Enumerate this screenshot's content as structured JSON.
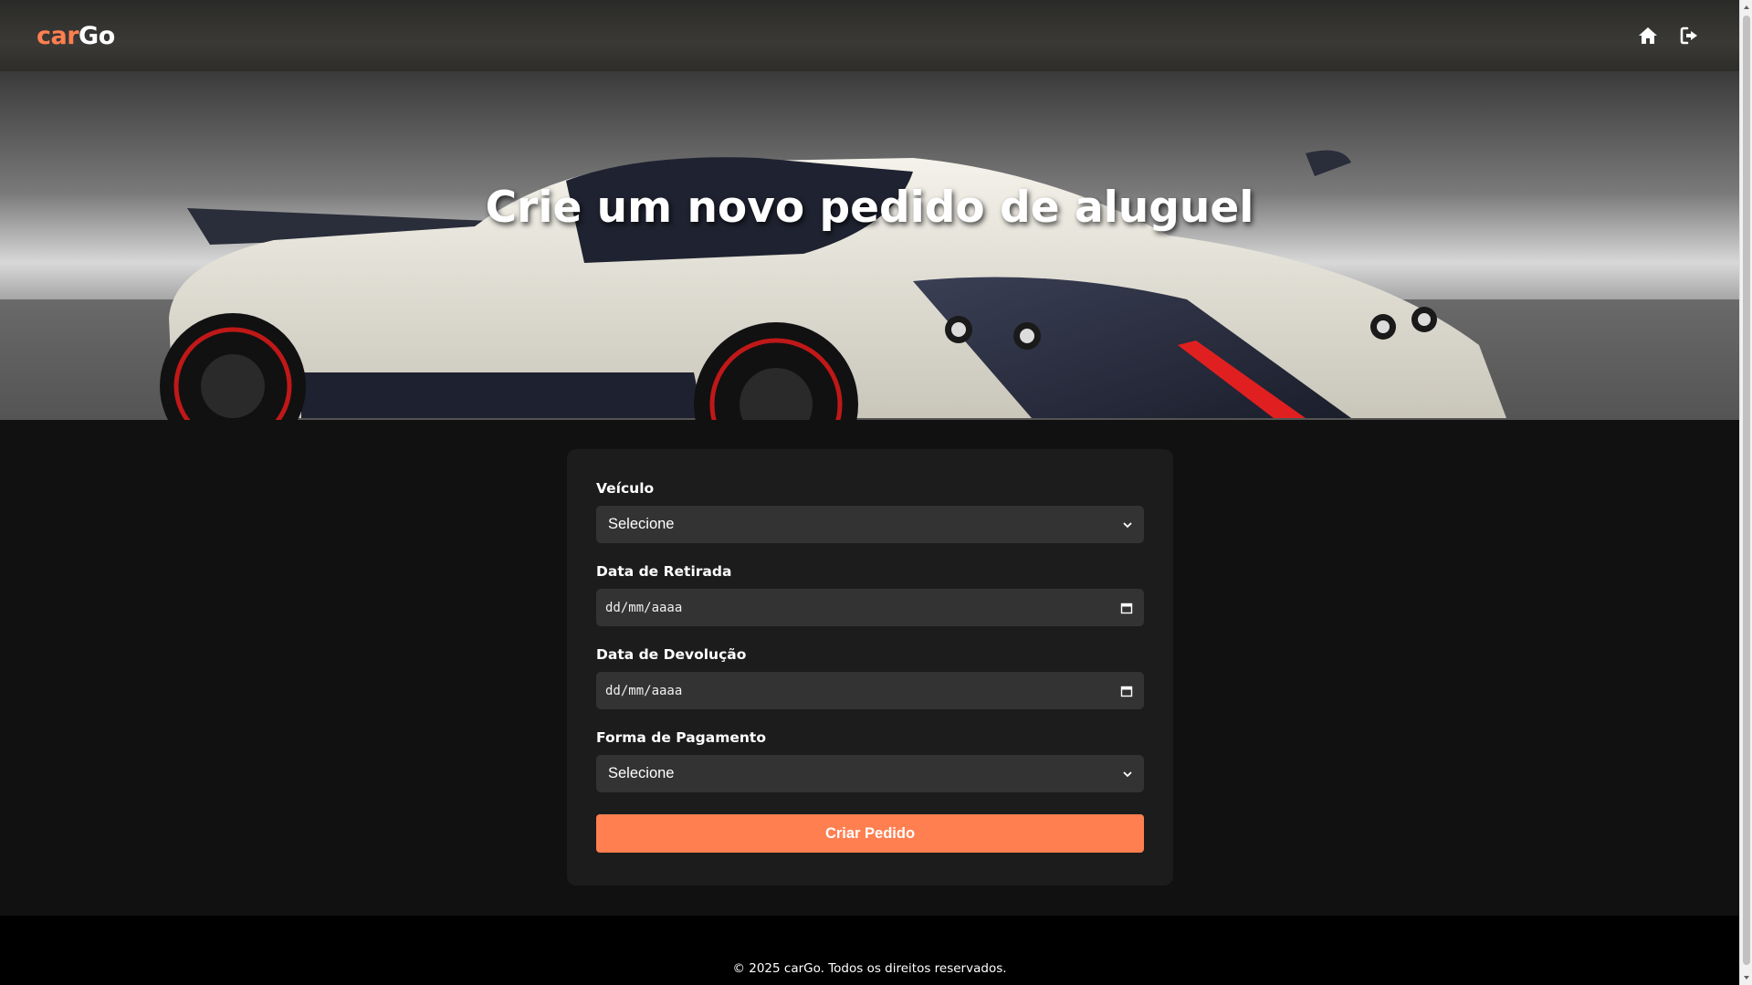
{
  "brand": {
    "logo_part1": "car",
    "logo_part2": "Go"
  },
  "nav": {
    "icons": [
      "home-icon",
      "logout-icon"
    ]
  },
  "hero": {
    "title": "Crie um novo pedido de aluguel"
  },
  "form": {
    "vehicle": {
      "label": "Veículo",
      "value": "Selecione"
    },
    "pickup_date": {
      "label": "Data de Retirada",
      "placeholder": "dd/mm/aaaa"
    },
    "return_date": {
      "label": "Data de Devolução",
      "placeholder": "dd/mm/aaaa"
    },
    "payment": {
      "label": "Forma de Pagamento",
      "value": "Selecione"
    },
    "submit_label": "Criar Pedido"
  },
  "footer": {
    "text": "© 2025 carGo. Todos os direitos reservados."
  },
  "colors": {
    "accent": "#ff7f50",
    "background": "#111111",
    "card": "#1c1c1c",
    "input": "#333333",
    "footer": "#000000"
  }
}
